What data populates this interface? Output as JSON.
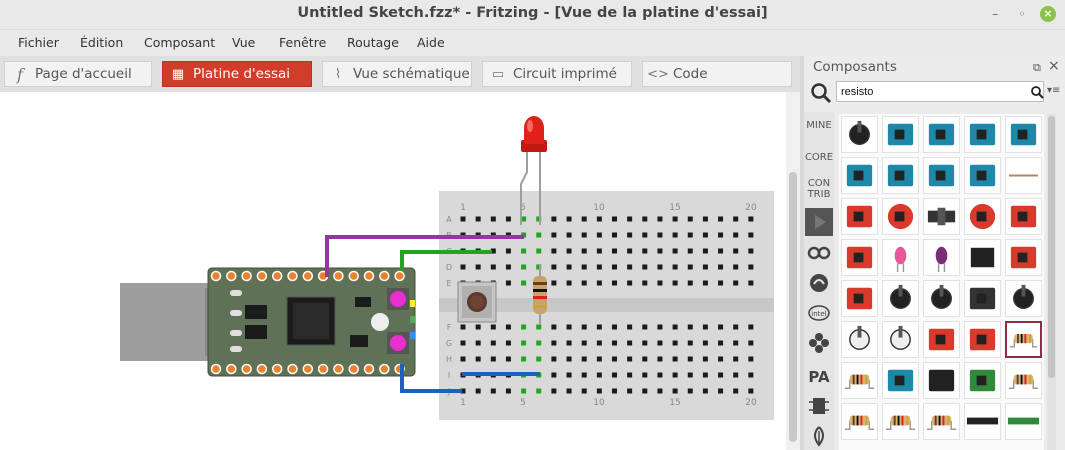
{
  "window": {
    "title": "Untitled Sketch.fzz* - Fritzing - [Vue de la platine d'essai]",
    "min_glyph": "–",
    "max_glyph": "◦",
    "close_glyph": "×"
  },
  "menu": [
    "Fichier",
    "Édition",
    "Composant",
    "Vue",
    "Fenêtre",
    "Routage",
    "Aide"
  ],
  "tabs": [
    {
      "label": "Page d'accueil",
      "icon": "fritzing-f-icon",
      "glyph": "f"
    },
    {
      "label": "Platine d'essai",
      "icon": "breadboard-icon",
      "glyph": "▦",
      "active": true
    },
    {
      "label": "Vue schématique",
      "icon": "schematic-icon",
      "glyph": "⌇"
    },
    {
      "label": "Circuit imprimé",
      "icon": "pcb-icon",
      "glyph": "▭"
    },
    {
      "label": "Code",
      "icon": "code-icon",
      "glyph": "<>"
    }
  ],
  "breadboard": {
    "row_letters_top": [
      "A",
      "B",
      "C",
      "D",
      "E"
    ],
    "row_letters_bottom": [
      "F",
      "G",
      "H",
      "I",
      "J"
    ],
    "column_numbers": [
      "1",
      "5",
      "10",
      "15",
      "20"
    ]
  },
  "panel": {
    "title": "Composants",
    "float_glyph": "⧉",
    "close_glyph": "×",
    "search_value": "resisto",
    "menu_glyph": "▾≡",
    "bins": [
      {
        "label": "MINE",
        "icon": null
      },
      {
        "label": "CORE",
        "icon": null
      },
      {
        "label": "CON TRIB",
        "icon": null
      },
      {
        "label": "",
        "icon": "play-icon"
      },
      {
        "label": "",
        "icon": "arduino-infinity-icon"
      },
      {
        "label": "",
        "icon": "seeed-icon"
      },
      {
        "label": "",
        "icon": "intel-icon"
      },
      {
        "label": "",
        "icon": "snowflake-icon"
      },
      {
        "label": "",
        "icon": "pa-icon"
      },
      {
        "label": "",
        "icon": "chip-icon"
      },
      {
        "label": "",
        "icon": "leaf-icon"
      }
    ],
    "parts": [
      "potentiometer",
      "arduino-blue",
      "arduino-blue",
      "arduino-blue",
      "arduino-blue",
      "arduino-blue",
      "arduino-blue",
      "arduino-blue",
      "arduino-uno",
      "resistor-line",
      "red-board",
      "red-round-board",
      "black-switch",
      "red-round-sensor",
      "red-board",
      "red-board",
      "pink-led",
      "purple-led",
      "m54-chip",
      "red-relay",
      "red-board",
      "black-pot",
      "black-pot",
      "black-box",
      "black-knob",
      "white-knob",
      "white-knob",
      "red-board",
      "red-board",
      "resistor",
      "resistor-small",
      "arduino-blue",
      "black-board",
      "green-board",
      "resistor",
      "resistor",
      "resistor",
      "resistor",
      "black-strip",
      "green-strip"
    ],
    "selected_part_index": 29,
    "bin_labels": {
      "mine": "MINE",
      "core": "CORE",
      "contrib_1": "CON",
      "contrib_2": "TRIB"
    }
  },
  "colors": {
    "active_tab": "#d13d2a",
    "breadboard": "#d9d9d9",
    "wire_purple": "#8e3a9a",
    "wire_green": "#1fa51f",
    "wire_blue": "#1f5fc0",
    "pcb_green": "#5f7258",
    "led_red": "#e0201a"
  }
}
